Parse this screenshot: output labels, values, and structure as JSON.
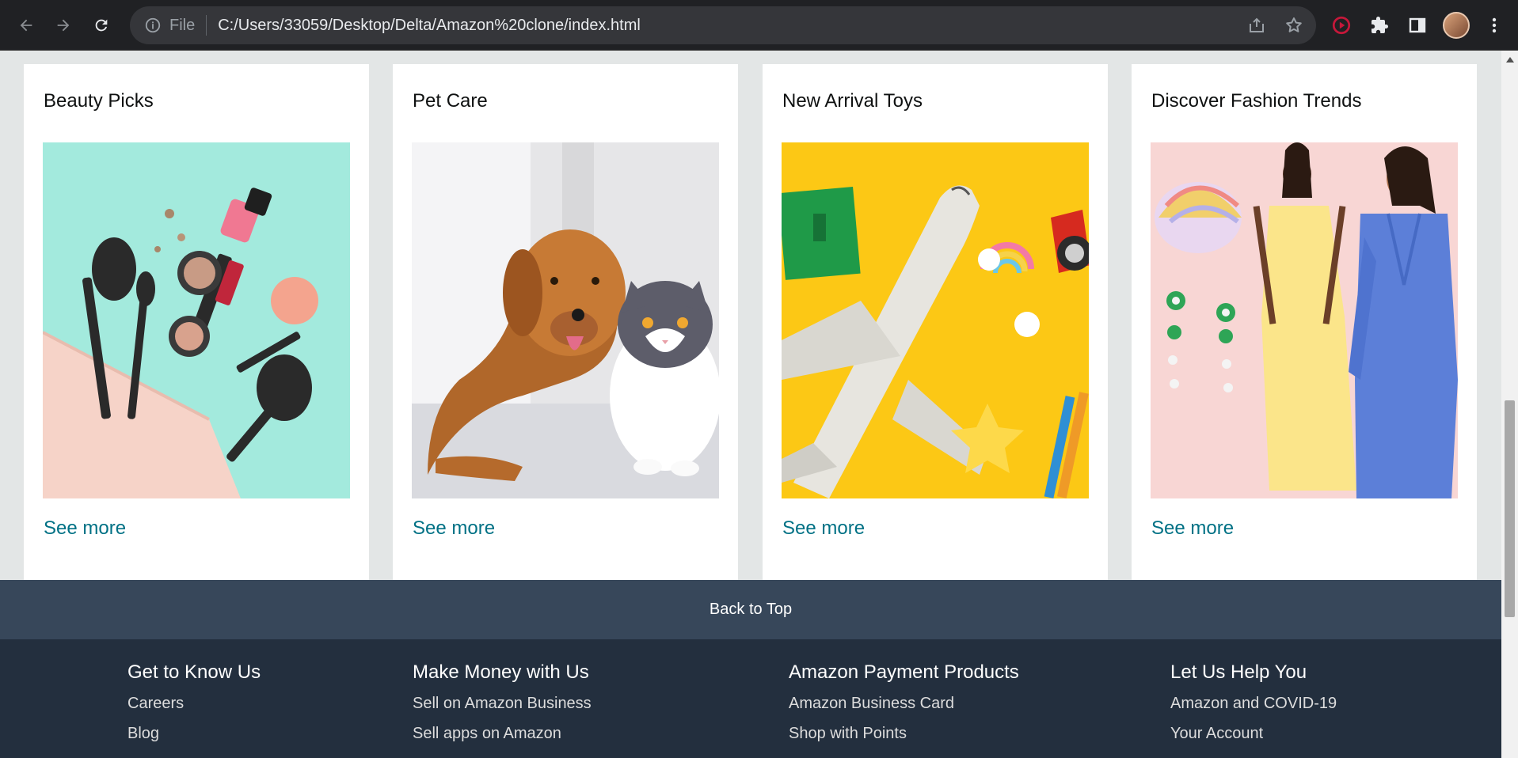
{
  "browser": {
    "scheme_label": "File",
    "url": "C:/Users/33059/Desktop/Delta/Amazon%20clone/index.html",
    "icons": [
      "back-icon",
      "forward-icon",
      "reload-icon",
      "info-icon",
      "share-icon",
      "star-icon",
      "record-icon",
      "extensions-icon",
      "side-panel-icon",
      "avatar",
      "menu-icon"
    ]
  },
  "cards": [
    {
      "title": "Beauty Picks",
      "link": "See more",
      "image": "beauty-products-image"
    },
    {
      "title": "Pet Care",
      "link": "See more",
      "image": "dog-and-cat-image"
    },
    {
      "title": "New Arrival Toys",
      "link": "See more",
      "image": "toy-airplane-image"
    },
    {
      "title": "Discover Fashion Trends",
      "link": "See more",
      "image": "fashion-models-image"
    }
  ],
  "back_to_top": "Back to Top",
  "footer": {
    "columns": [
      {
        "heading": "Get to Know Us",
        "links": [
          "Careers",
          "Blog"
        ]
      },
      {
        "heading": "Make Money with Us",
        "links": [
          "Sell on Amazon Business",
          "Sell apps on Amazon"
        ]
      },
      {
        "heading": "Amazon Payment Products",
        "links": [
          "Amazon Business Card",
          "Shop with Points"
        ]
      },
      {
        "heading": "Let Us Help You",
        "links": [
          "Amazon and COVID-19",
          "Your Account"
        ]
      }
    ]
  },
  "colors": {
    "page_bg": "#e3e6e6",
    "link": "#007185",
    "back_to_top_bg": "#37475a",
    "footer_bg": "#232f3e",
    "chrome_bg": "#202124"
  }
}
